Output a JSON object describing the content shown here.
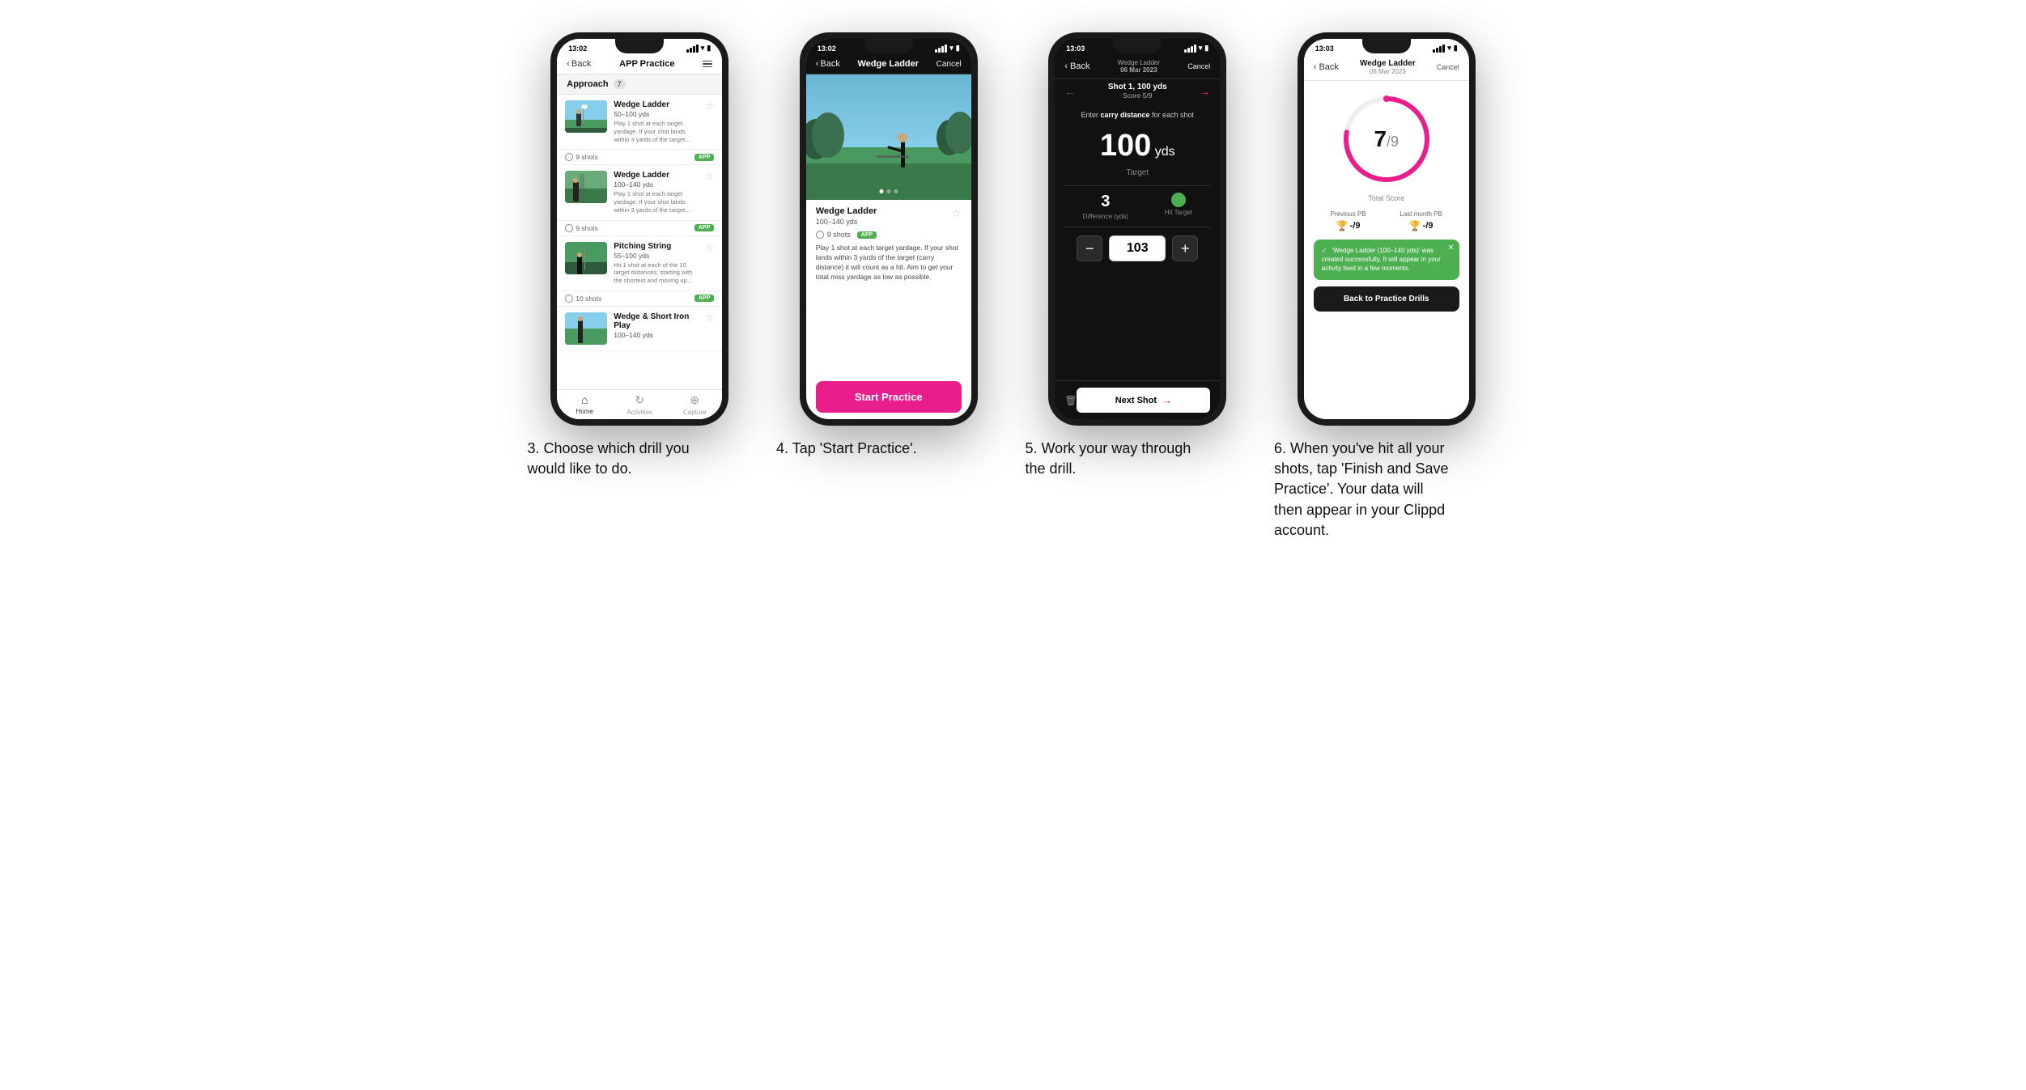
{
  "phones": [
    {
      "id": "phone3",
      "time": "13:02",
      "screen": "practice-list",
      "nav": {
        "back": "Back",
        "title": "APP Practice",
        "hasMenu": true
      },
      "section": {
        "label": "Approach",
        "badge": "7"
      },
      "drills": [
        {
          "name": "Wedge Ladder",
          "range": "50–100 yds",
          "desc": "Play 1 shot at each target yardage. If your shot lands within 3 yards of the target...",
          "shots": "9 shots",
          "badge": "APP"
        },
        {
          "name": "Wedge Ladder",
          "range": "100–140 yds",
          "desc": "Play 1 shot at each target yardage. If your shot lands within 3 yards of the target...",
          "shots": "9 shots",
          "badge": "APP"
        },
        {
          "name": "Pitching String",
          "range": "55–100 yds",
          "desc": "Hit 1 shot at each of the 10 target distances, starting with the shortest and moving up...",
          "shots": "10 shots",
          "badge": "APP"
        },
        {
          "name": "Wedge & Short Iron Play",
          "range": "100–140 yds",
          "desc": "",
          "shots": "",
          "badge": ""
        }
      ],
      "tabs": [
        {
          "label": "Home",
          "icon": "⌂",
          "active": true
        },
        {
          "label": "Activities",
          "icon": "♻",
          "active": false
        },
        {
          "label": "Capture",
          "icon": "⊕",
          "active": false
        }
      ]
    },
    {
      "id": "phone4",
      "time": "13:02",
      "screen": "drill-detail",
      "nav": {
        "back": "Back",
        "title": "Wedge Ladder",
        "right": "Cancel"
      },
      "drill": {
        "name": "Wedge Ladder",
        "range": "100–140 yds",
        "shots": "9 shots",
        "badge": "APP",
        "desc": "Play 1 shot at each target yardage. If your shot lands within 3 yards of the target (carry distance) it will count as a hit. Aim to get your total miss yardage as low as possible."
      },
      "startBtn": "Start Practice",
      "imageDots": [
        true,
        false,
        false
      ]
    },
    {
      "id": "phone5",
      "time": "13:03",
      "screen": "shot-entry",
      "nav": {
        "subtitle": "Wedge Ladder",
        "date": "06 Mar 2023",
        "right": "Cancel",
        "shotLabel": "Shot 1, 100 yds",
        "scoreLabel": "Score 5/9"
      },
      "instruction": "Enter carry distance for each shot",
      "target": {
        "value": "100",
        "unit": "yds",
        "label": "Target"
      },
      "stats": {
        "difference": "3",
        "differenceLabel": "Difference (yds)",
        "hitTarget": "Hit Target"
      },
      "stepperValue": "103",
      "nextShotLabel": "Next Shot"
    },
    {
      "id": "phone6",
      "time": "13:03",
      "screen": "score",
      "nav": {
        "subtitle": "Wedge Ladder",
        "date": "06 Mar 2023",
        "right": "Cancel"
      },
      "score": {
        "value": "7",
        "total": "9",
        "label": "Total Score"
      },
      "previousPB": {
        "label": "Previous PB",
        "value": "-/9"
      },
      "lastMonthPB": {
        "label": "Last month PB",
        "value": "-/9"
      },
      "toast": "'Wedge Ladder (100–140 yds)' was created successfully. It will appear in your activity feed in a few moments.",
      "backBtn": "Back to Practice Drills"
    }
  ],
  "captions": [
    "3. Choose which drill you would like to do.",
    "4. Tap 'Start Practice'.",
    "5. Work your way through the drill.",
    "6. When you've hit all your shots, tap 'Finish and Save Practice'. Your data will then appear in your Clippd account."
  ]
}
